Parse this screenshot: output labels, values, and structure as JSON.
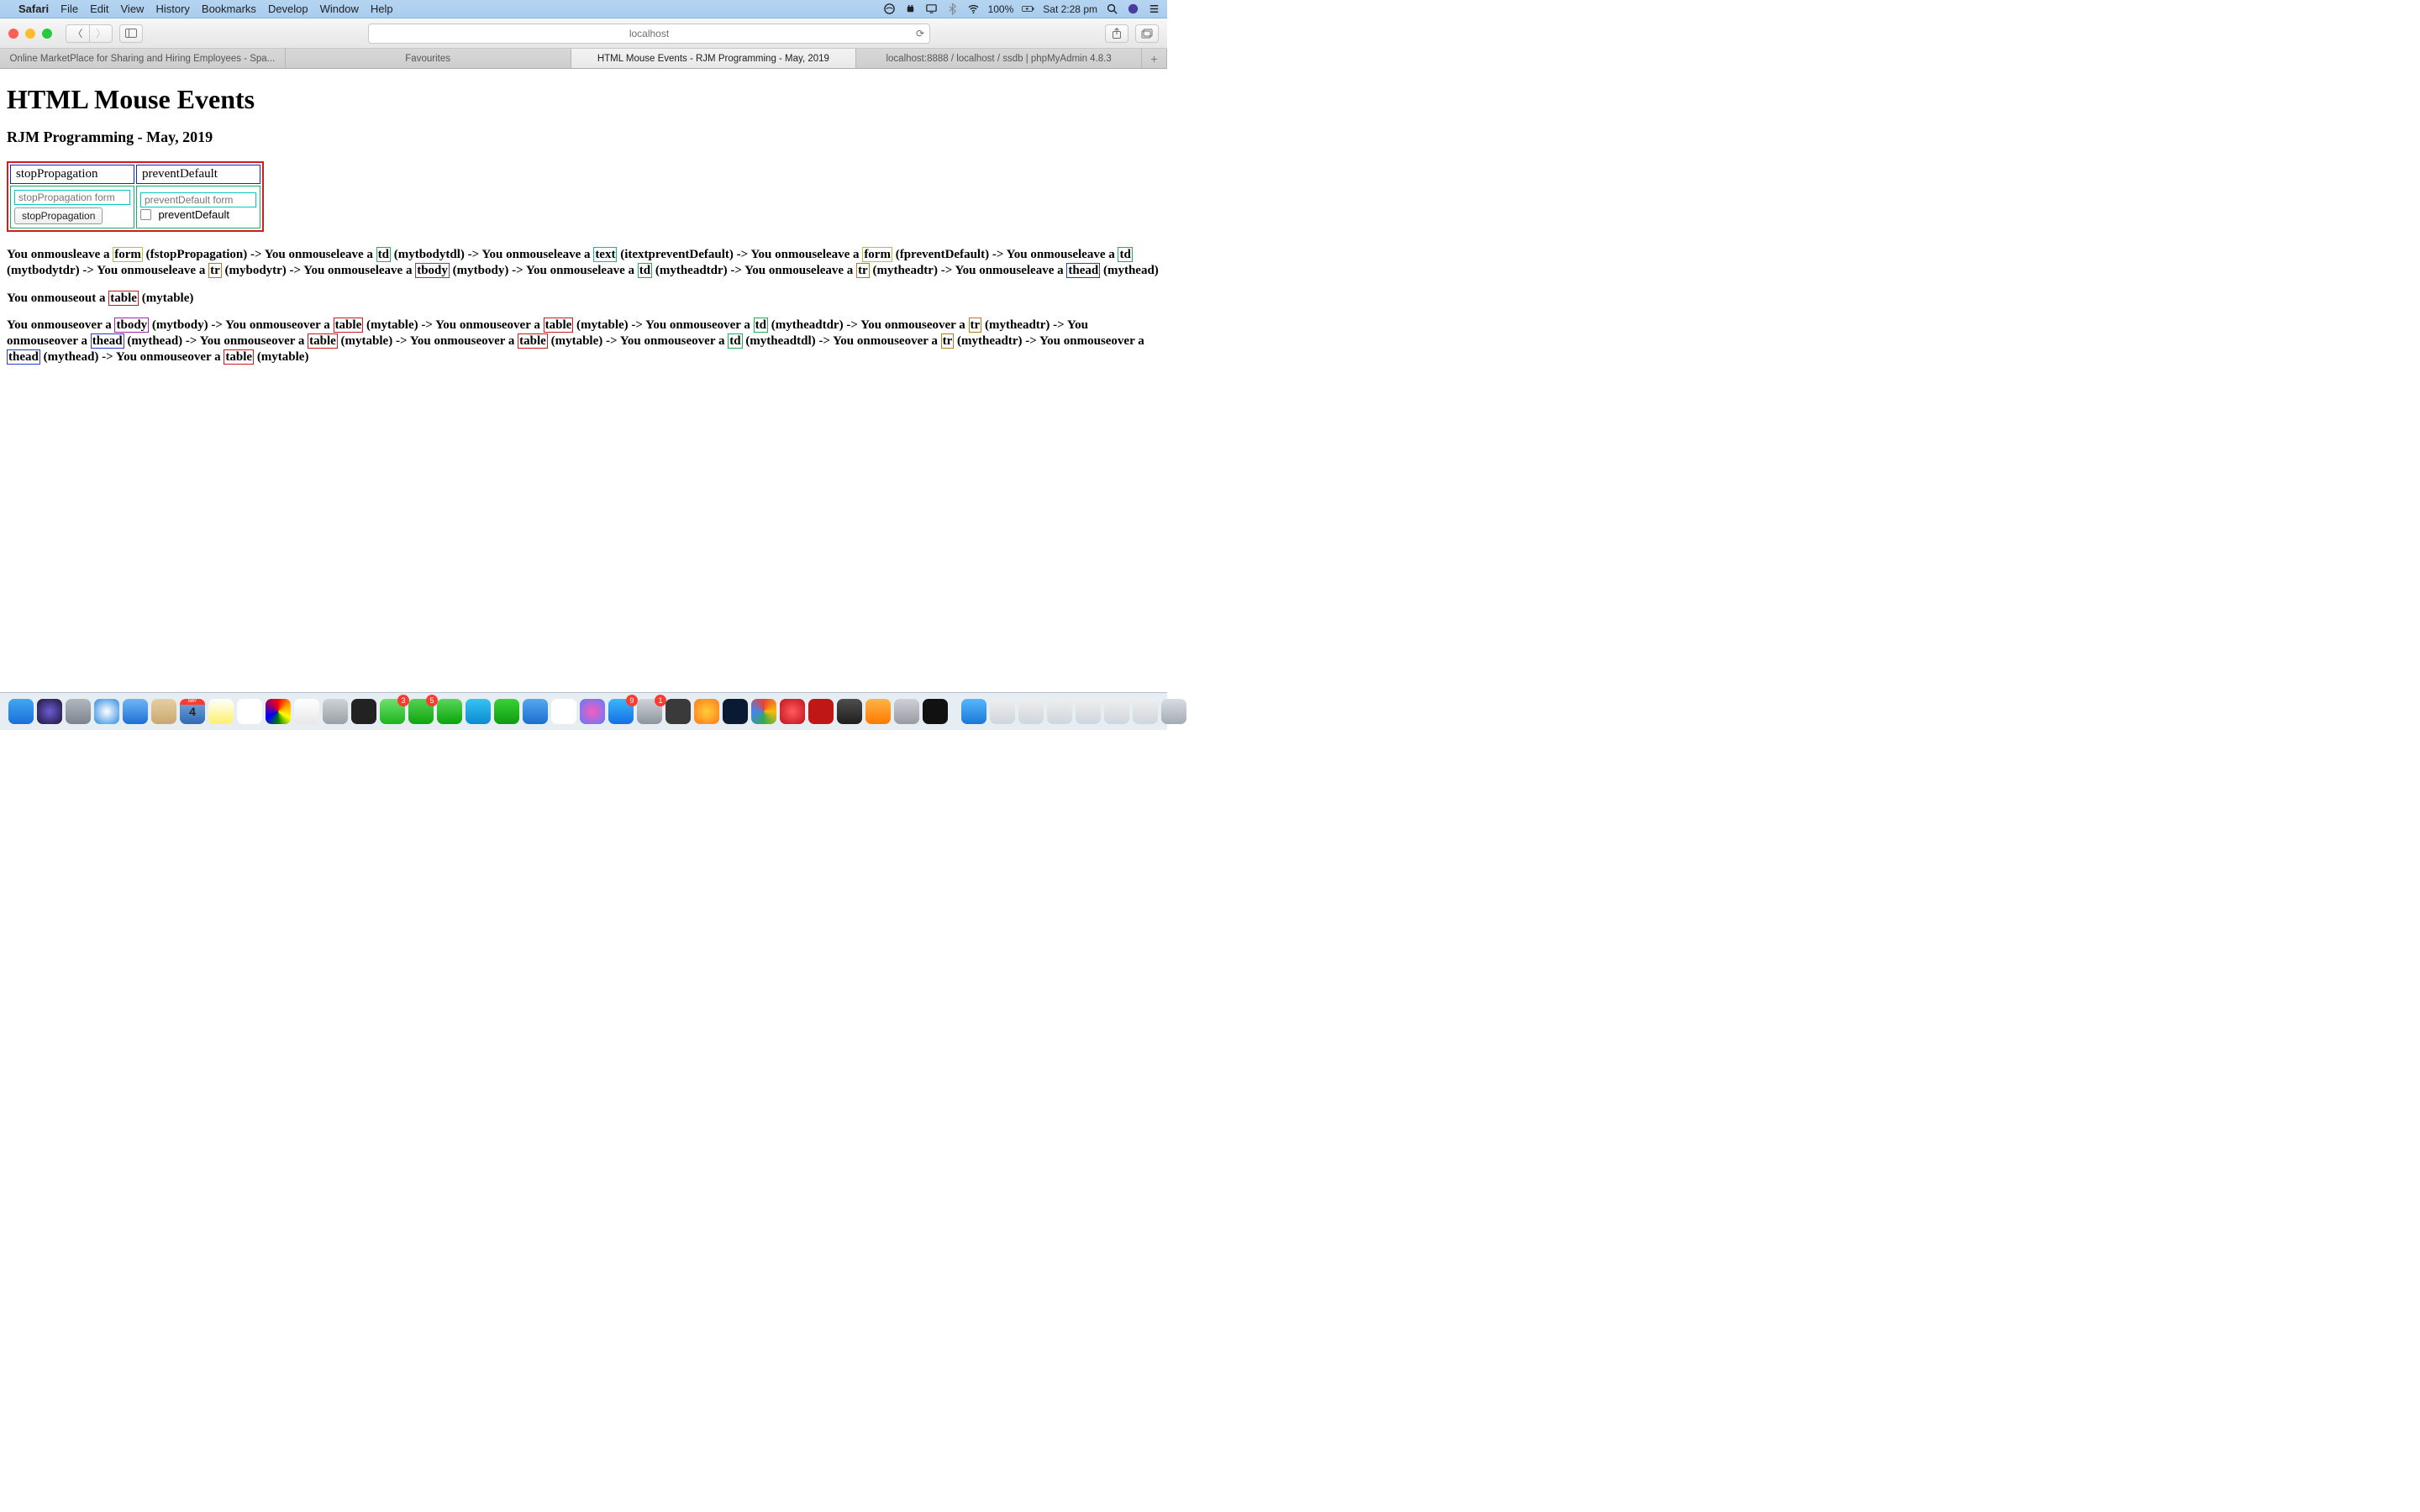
{
  "menubar": {
    "app": "Safari",
    "items": [
      "File",
      "Edit",
      "View",
      "History",
      "Bookmarks",
      "Develop",
      "Window",
      "Help"
    ],
    "battery": "100%",
    "clock": "Sat 2:28 pm"
  },
  "browser": {
    "url": "localhost",
    "tabs": [
      "Online MarketPlace for Sharing and Hiring Employees - Spa...",
      "Favourites",
      "HTML Mouse Events - RJM Programming - May, 2019",
      "localhost:8888 / localhost / ssdb | phpMyAdmin 4.8.3"
    ],
    "activeTab": 2
  },
  "page": {
    "h1": "HTML Mouse Events",
    "h3": "RJM Programming - May, 2019",
    "thead": [
      "stopPropagation",
      "preventDefault"
    ],
    "cell1": {
      "placeholder": "stopPropagation form",
      "button": "stopPropagation"
    },
    "cell2": {
      "placeholder": "preventDefault form",
      "cblabel": "preventDefault"
    },
    "log1": [
      {
        "pre": "You onmousleave a ",
        "tag": "form",
        "cls": "form-hl",
        "post": " (fstopPropagation) -> "
      },
      {
        "pre": "You onmouseleave a ",
        "tag": "td",
        "cls": "td-hl",
        "post": " (mytbodytdl) -> "
      },
      {
        "pre": "You onmouseleave a ",
        "tag": "text",
        "cls": "text-hl",
        "post": " (itextpreventDefault) -> "
      },
      {
        "pre": "You onmouseleave a ",
        "tag": "form",
        "cls": "form-hl",
        "post": " (fpreventDefault) -> "
      },
      {
        "pre": "You onmouseleave a ",
        "tag": "td",
        "cls": "td-hl",
        "post": " (mytbodytdr) -> "
      },
      {
        "pre": "You onmouseleave a ",
        "tag": "tr",
        "cls": "tr-hl",
        "post": " (mybodytr) -> "
      },
      {
        "pre": "You onmouseleave a ",
        "tag": "tbody",
        "cls": "tbody-hl",
        "post": " (mytbody) -> "
      },
      {
        "pre": "You onmouseleave a ",
        "tag": "td",
        "cls": "td-hl",
        "post": " (mytheadtdr) -> "
      },
      {
        "pre": "You onmouseleave a ",
        "tag": "tr",
        "cls": "tr-hl",
        "post": " (mytheadtr) -> "
      },
      {
        "pre": "You onmouseleave a ",
        "tag": "thead",
        "cls": "thead-hl",
        "post": " (mythead)"
      }
    ],
    "log2": [
      {
        "pre": "You onmouseout a ",
        "tag": "table",
        "cls": "table-hl",
        "post": " (mytable)"
      }
    ],
    "log3": [
      {
        "pre": "You onmouseover a ",
        "tag": "tbody",
        "cls": "tbody-hl",
        "post": " (mytbody) -> "
      },
      {
        "pre": "You onmouseover a ",
        "tag": "table",
        "cls": "table-hl",
        "post": " (mytable) -> "
      },
      {
        "pre": "You onmouseover a ",
        "tag": "table",
        "cls": "table-hl",
        "post": " (mytable) -> "
      },
      {
        "pre": "You onmouseover a ",
        "tag": "td",
        "cls": "td-hl",
        "post": " (mytheadtdr) -> "
      },
      {
        "pre": "You onmouseover a ",
        "tag": "tr",
        "cls": "tr-hl",
        "post": " (mytheadtr) -> "
      },
      {
        "pre": "You onmouseover a ",
        "tag": "thead",
        "cls": "thead-hl",
        "post": " (mythead) -> "
      },
      {
        "pre": "You onmouseover a ",
        "tag": "table",
        "cls": "table-hl",
        "post": " (mytable) -> "
      },
      {
        "pre": "You onmouseover a ",
        "tag": "table",
        "cls": "table-hl",
        "post": " (mytable) -> "
      },
      {
        "pre": "You onmouseover a ",
        "tag": "td",
        "cls": "td-hl",
        "post": " (mytheadtdl) -> "
      },
      {
        "pre": "You onmouseover a ",
        "tag": "tr",
        "cls": "tr-hl",
        "post": " (mytheadtr) -> "
      },
      {
        "pre": "You onmouseover a ",
        "tag": "thead",
        "cls": "thead-hl",
        "post": " (mythead) -> "
      },
      {
        "pre": "You onmouseover a ",
        "tag": "table",
        "cls": "table-hl",
        "post": " (mytable)"
      }
    ]
  },
  "dock": {
    "calendar": {
      "month": "MAY",
      "day": "4"
    },
    "items": [
      {
        "name": "finder",
        "bg": "linear-gradient(#3fa8f4,#1b6fd8)"
      },
      {
        "name": "siri",
        "bg": "radial-gradient(circle,#6e5bd8,#1b1633)"
      },
      {
        "name": "launchpad",
        "bg": "linear-gradient(#b0b7bf,#7c848d)"
      },
      {
        "name": "safari",
        "bg": "radial-gradient(circle,#fff,#2a8ae2)"
      },
      {
        "name": "mail",
        "bg": "linear-gradient(#6fb6f6,#1e6fd6)"
      },
      {
        "name": "contacts",
        "bg": "linear-gradient(#e7cfa3,#c8a86e)"
      },
      {
        "name": "calendar"
      },
      {
        "name": "notes",
        "bg": "linear-gradient(#fff,#fff06a)"
      },
      {
        "name": "reminders",
        "bg": "#fff"
      },
      {
        "name": "colorpicker",
        "bg": "conic-gradient(red,orange,yellow,green,blue,purple,red)"
      },
      {
        "name": "textedit",
        "bg": "linear-gradient(#fff,#e8e8e8)"
      },
      {
        "name": "systemprefs",
        "bg": "linear-gradient(#cfd3d8,#9aa0a7)"
      },
      {
        "name": "activity",
        "bg": "#222"
      },
      {
        "name": "messages",
        "bg": "linear-gradient(#6fe06f,#1db51d)",
        "badge": "3"
      },
      {
        "name": "wechat",
        "bg": "linear-gradient(#54d354,#0fa50f)",
        "badge": "5"
      },
      {
        "name": "line",
        "bg": "linear-gradient(#5ad55a,#0aa50a)"
      },
      {
        "name": "skype",
        "bg": "linear-gradient(#37c3f3,#0b8bd1)"
      },
      {
        "name": "numbers",
        "bg": "linear-gradient(#38d338,#0f9a0f)"
      },
      {
        "name": "dropbox",
        "bg": "linear-gradient(#55a7ef,#1a6fcf)"
      },
      {
        "name": "blocked",
        "bg": "#fff"
      },
      {
        "name": "itunes",
        "bg": "radial-gradient(circle,#fb5bbd,#5b7dfb)"
      },
      {
        "name": "appstore",
        "bg": "linear-gradient(#3cb6fb,#1470e4)",
        "badge": "9"
      },
      {
        "name": "automator",
        "bg": "linear-gradient(#d0d4d9,#8d949c)",
        "badge": "1"
      },
      {
        "name": "atom",
        "bg": "#3a3a3a"
      },
      {
        "name": "firefox",
        "bg": "radial-gradient(circle,#ffcd3a,#ff7a17)"
      },
      {
        "name": "photoshop",
        "bg": "#0b1a33"
      },
      {
        "name": "chrome",
        "bg": "conic-gradient(#ea4335,#fbbc05,#34a853,#4285f4,#ea4335)"
      },
      {
        "name": "opera",
        "bg": "radial-gradient(circle,#ff5b5b,#c1111f)"
      },
      {
        "name": "filezilla",
        "bg": "#bf1616"
      },
      {
        "name": "mamp",
        "bg": "linear-gradient(#4e4e4e,#1e1e1e)"
      },
      {
        "name": "paint",
        "bg": "linear-gradient(#ffb347,#ff7b00)"
      },
      {
        "name": "smoke",
        "bg": "linear-gradient(#cfcfd6,#9a9aa3)"
      },
      {
        "name": "terminal",
        "bg": "#111"
      }
    ],
    "right": [
      {
        "name": "magnifier",
        "bg": "linear-gradient(#56b7ff,#1b78d6)"
      },
      {
        "name": "preview1",
        "bg": "linear-gradient(#eee,#cfd6dd)"
      },
      {
        "name": "preview2",
        "bg": "linear-gradient(#eee,#cfd6dd)"
      },
      {
        "name": "preview3",
        "bg": "linear-gradient(#eee,#cfd6dd)"
      },
      {
        "name": "preview4",
        "bg": "linear-gradient(#eee,#cfd6dd)"
      },
      {
        "name": "preview5",
        "bg": "linear-gradient(#eee,#cfd6dd)"
      },
      {
        "name": "preview6",
        "bg": "linear-gradient(#eee,#cfd6dd)"
      },
      {
        "name": "trash",
        "bg": "linear-gradient(#d8dde2,#a4acb4)"
      }
    ]
  }
}
